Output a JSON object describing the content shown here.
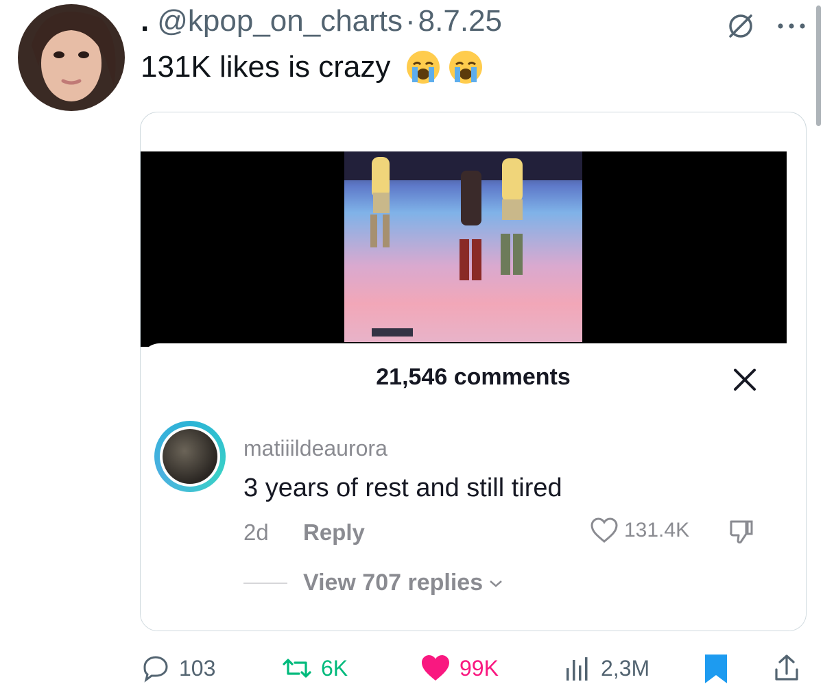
{
  "tweet": {
    "lead_dot": ".",
    "handle": "@kpop_on_charts",
    "separator": "·",
    "date": "8.7.25",
    "text": "131K likes is crazy",
    "emoji": "crying-face-emoji",
    "top_icons": [
      "slash-circle-icon",
      "more-icon"
    ]
  },
  "media": {
    "comments_header": "21,546 comments",
    "comment": {
      "username": "matiiildeaurora",
      "text": "3 years of rest and still tired",
      "age": "2d",
      "reply_label": "Reply",
      "likes": "131.4K",
      "view_replies": "View 707 replies"
    }
  },
  "actions": {
    "replies": "103",
    "reposts": "6K",
    "likes": "99K",
    "views": "2,3M"
  },
  "colors": {
    "repost": "#00ba7c",
    "like": "#f91880",
    "bookmark": "#1d9bf0",
    "muted": "#536471"
  }
}
